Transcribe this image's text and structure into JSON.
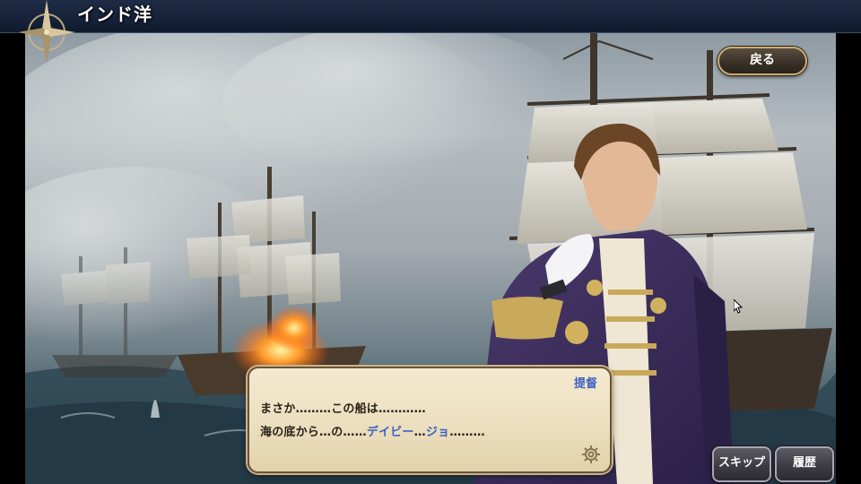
{
  "header": {
    "location_title": "インド洋",
    "compass_icon": "compass-rose-icon"
  },
  "buttons": {
    "back_label": "戻る",
    "skip_label": "スキップ",
    "history_label": "履歴"
  },
  "dialog": {
    "speaker": "提督",
    "line1": "まさか………この船は…………",
    "line2": {
      "part1": "海の底から…の……",
      "highlight1": "デイビー",
      "part2": "…",
      "highlight2": "ジョ",
      "part3": "………"
    },
    "settings_icon": "gear-icon"
  },
  "colors": {
    "header_bg": "#16223a",
    "dialog_bg": "#ecdfbf",
    "speaker_name": "#3d5fbf",
    "button_border": "#c9ad74"
  }
}
